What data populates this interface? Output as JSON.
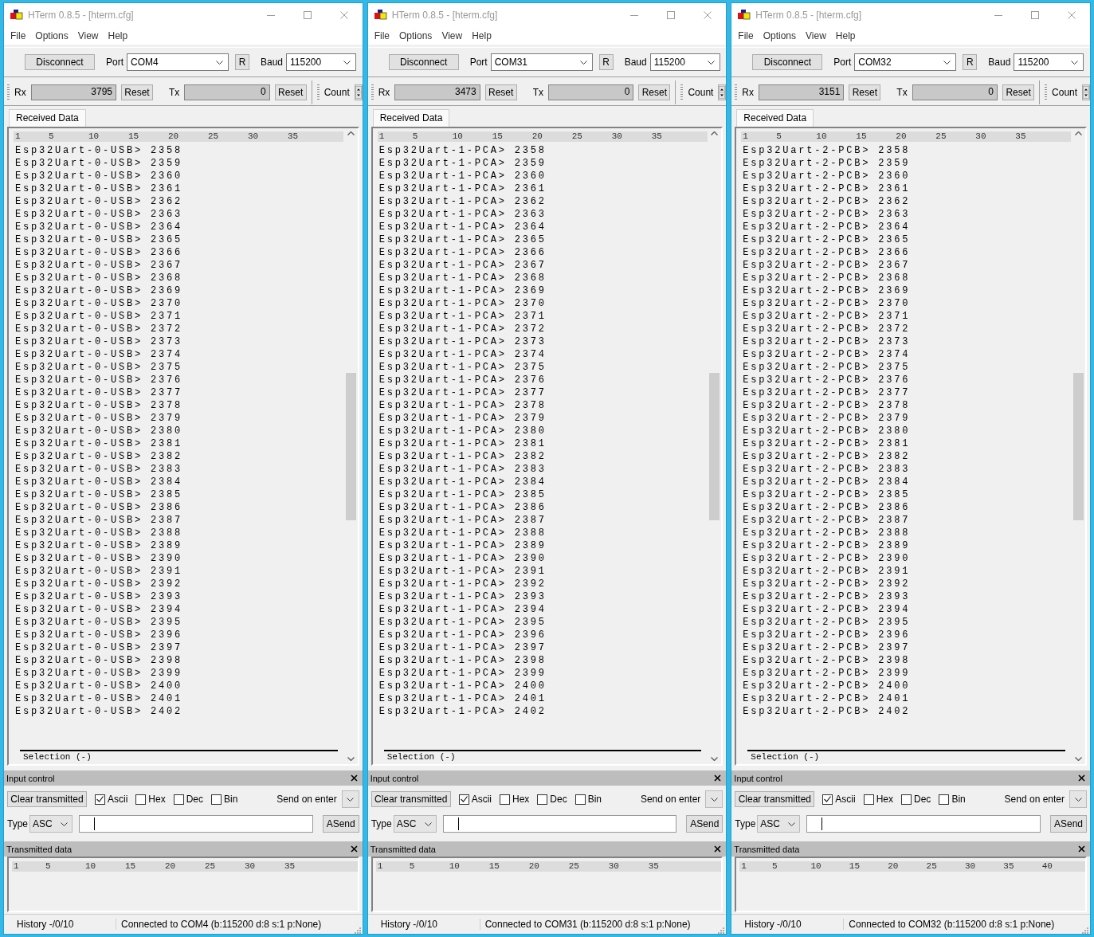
{
  "windows": [
    {
      "title": "HTerm 0.8.5 - [hterm.cfg]",
      "menu": [
        "File",
        "Options",
        "View",
        "Help"
      ],
      "connect_button": "Disconnect",
      "port_label": "Port",
      "port": "COM4",
      "refresh_button": "R",
      "baud_label": "Baud",
      "baud": "115200",
      "rx_label": "Rx",
      "rx_count": "3795",
      "rx_reset": "Reset",
      "tx_label": "Tx",
      "tx_count": "0",
      "tx_reset": "Reset",
      "count_label": "Count",
      "tabs": [
        {
          "label": "Received Data",
          "selected": true
        }
      ],
      "received_ruler": [
        "1",
        "5",
        "10",
        "15",
        "20",
        "25",
        "30",
        "35"
      ],
      "received_lines": [
        "Esp32Uart-0-USB> 2358",
        "Esp32Uart-0-USB> 2359",
        "Esp32Uart-0-USB> 2360",
        "Esp32Uart-0-USB> 2361",
        "Esp32Uart-0-USB> 2362",
        "Esp32Uart-0-USB> 2363",
        "Esp32Uart-0-USB> 2364",
        "Esp32Uart-0-USB> 2365",
        "Esp32Uart-0-USB> 2366",
        "Esp32Uart-0-USB> 2367",
        "Esp32Uart-0-USB> 2368",
        "Esp32Uart-0-USB> 2369",
        "Esp32Uart-0-USB> 2370",
        "Esp32Uart-0-USB> 2371",
        "Esp32Uart-0-USB> 2372",
        "Esp32Uart-0-USB> 2373",
        "Esp32Uart-0-USB> 2374",
        "Esp32Uart-0-USB> 2375",
        "Esp32Uart-0-USB> 2376",
        "Esp32Uart-0-USB> 2377",
        "Esp32Uart-0-USB> 2378",
        "Esp32Uart-0-USB> 2379",
        "Esp32Uart-0-USB> 2380",
        "Esp32Uart-0-USB> 2381",
        "Esp32Uart-0-USB> 2382",
        "Esp32Uart-0-USB> 2383",
        "Esp32Uart-0-USB> 2384",
        "Esp32Uart-0-USB> 2385",
        "Esp32Uart-0-USB> 2386",
        "Esp32Uart-0-USB> 2387",
        "Esp32Uart-0-USB> 2388",
        "Esp32Uart-0-USB> 2389",
        "Esp32Uart-0-USB> 2390",
        "Esp32Uart-0-USB> 2391",
        "Esp32Uart-0-USB> 2392",
        "Esp32Uart-0-USB> 2393",
        "Esp32Uart-0-USB> 2394",
        "Esp32Uart-0-USB> 2395",
        "Esp32Uart-0-USB> 2396",
        "Esp32Uart-0-USB> 2397",
        "Esp32Uart-0-USB> 2398",
        "Esp32Uart-0-USB> 2399",
        "Esp32Uart-0-USB> 2400",
        "Esp32Uart-0-USB> 2401",
        "Esp32Uart-0-USB> 2402"
      ],
      "selection_label": "Selection (-)",
      "input_control": {
        "title": "Input control",
        "clear_button": "Clear transmitted",
        "formats": [
          {
            "label": "Ascii",
            "checked": true
          },
          {
            "label": "Hex",
            "checked": false
          },
          {
            "label": "Dec",
            "checked": false
          },
          {
            "label": "Bin",
            "checked": false
          }
        ],
        "send_on_enter_label": "Send on enter",
        "type_label": "Type",
        "type_value": "ASC",
        "send_button": "ASend"
      },
      "transmitted": {
        "title": "Transmitted data",
        "ruler": [
          "1",
          "5",
          "10",
          "15",
          "20",
          "25",
          "30",
          "35"
        ]
      },
      "status": {
        "history": "History -/0/10",
        "connection": "Connected to COM4 (b:115200 d:8 s:1 p:None)"
      }
    },
    {
      "title": "HTerm 0.8.5 - [hterm.cfg]",
      "menu": [
        "File",
        "Options",
        "View",
        "Help"
      ],
      "connect_button": "Disconnect",
      "port_label": "Port",
      "port": "COM31",
      "refresh_button": "R",
      "baud_label": "Baud",
      "baud": "115200",
      "rx_label": "Rx",
      "rx_count": "3473",
      "rx_reset": "Reset",
      "tx_label": "Tx",
      "tx_count": "0",
      "tx_reset": "Reset",
      "count_label": "Count",
      "tabs": [
        {
          "label": "Received Data",
          "selected": true
        }
      ],
      "received_ruler": [
        "1",
        "5",
        "10",
        "15",
        "20",
        "25",
        "30",
        "35"
      ],
      "received_lines": [
        "Esp32Uart-1-PCA> 2358",
        "Esp32Uart-1-PCA> 2359",
        "Esp32Uart-1-PCA> 2360",
        "Esp32Uart-1-PCA> 2361",
        "Esp32Uart-1-PCA> 2362",
        "Esp32Uart-1-PCA> 2363",
        "Esp32Uart-1-PCA> 2364",
        "Esp32Uart-1-PCA> 2365",
        "Esp32Uart-1-PCA> 2366",
        "Esp32Uart-1-PCA> 2367",
        "Esp32Uart-1-PCA> 2368",
        "Esp32Uart-1-PCA> 2369",
        "Esp32Uart-1-PCA> 2370",
        "Esp32Uart-1-PCA> 2371",
        "Esp32Uart-1-PCA> 2372",
        "Esp32Uart-1-PCA> 2373",
        "Esp32Uart-1-PCA> 2374",
        "Esp32Uart-1-PCA> 2375",
        "Esp32Uart-1-PCA> 2376",
        "Esp32Uart-1-PCA> 2377",
        "Esp32Uart-1-PCA> 2378",
        "Esp32Uart-1-PCA> 2379",
        "Esp32Uart-1-PCA> 2380",
        "Esp32Uart-1-PCA> 2381",
        "Esp32Uart-1-PCA> 2382",
        "Esp32Uart-1-PCA> 2383",
        "Esp32Uart-1-PCA> 2384",
        "Esp32Uart-1-PCA> 2385",
        "Esp32Uart-1-PCA> 2386",
        "Esp32Uart-1-PCA> 2387",
        "Esp32Uart-1-PCA> 2388",
        "Esp32Uart-1-PCA> 2389",
        "Esp32Uart-1-PCA> 2390",
        "Esp32Uart-1-PCA> 2391",
        "Esp32Uart-1-PCA> 2392",
        "Esp32Uart-1-PCA> 2393",
        "Esp32Uart-1-PCA> 2394",
        "Esp32Uart-1-PCA> 2395",
        "Esp32Uart-1-PCA> 2396",
        "Esp32Uart-1-PCA> 2397",
        "Esp32Uart-1-PCA> 2398",
        "Esp32Uart-1-PCA> 2399",
        "Esp32Uart-1-PCA> 2400",
        "Esp32Uart-1-PCA> 2401",
        "Esp32Uart-1-PCA> 2402"
      ],
      "selection_label": "Selection (-)",
      "input_control": {
        "title": "Input control",
        "clear_button": "Clear transmitted",
        "formats": [
          {
            "label": "Ascii",
            "checked": true
          },
          {
            "label": "Hex",
            "checked": false
          },
          {
            "label": "Dec",
            "checked": false
          },
          {
            "label": "Bin",
            "checked": false
          }
        ],
        "send_on_enter_label": "Send on enter",
        "type_label": "Type",
        "type_value": "ASC",
        "send_button": "ASend"
      },
      "transmitted": {
        "title": "Transmitted data",
        "ruler": [
          "1",
          "5",
          "10",
          "15",
          "20",
          "25",
          "30",
          "35"
        ]
      },
      "status": {
        "history": "History -/0/10",
        "connection": "Connected to COM31 (b:115200 d:8 s:1 p:None)"
      }
    },
    {
      "title": "HTerm 0.8.5 - [hterm.cfg]",
      "menu": [
        "File",
        "Options",
        "View",
        "Help"
      ],
      "connect_button": "Disconnect",
      "port_label": "Port",
      "port": "COM32",
      "refresh_button": "R",
      "baud_label": "Baud",
      "baud": "115200",
      "rx_label": "Rx",
      "rx_count": "3151",
      "rx_reset": "Reset",
      "tx_label": "Tx",
      "tx_count": "0",
      "tx_reset": "Reset",
      "count_label": "Count",
      "tabs": [
        {
          "label": "Received Data",
          "selected": true
        }
      ],
      "received_ruler": [
        "1",
        "5",
        "10",
        "15",
        "20",
        "25",
        "30",
        "35"
      ],
      "received_lines": [
        "Esp32Uart-2-PCB> 2358",
        "Esp32Uart-2-PCB> 2359",
        "Esp32Uart-2-PCB> 2360",
        "Esp32Uart-2-PCB> 2361",
        "Esp32Uart-2-PCB> 2362",
        "Esp32Uart-2-PCB> 2363",
        "Esp32Uart-2-PCB> 2364",
        "Esp32Uart-2-PCB> 2365",
        "Esp32Uart-2-PCB> 2366",
        "Esp32Uart-2-PCB> 2367",
        "Esp32Uart-2-PCB> 2368",
        "Esp32Uart-2-PCB> 2369",
        "Esp32Uart-2-PCB> 2370",
        "Esp32Uart-2-PCB> 2371",
        "Esp32Uart-2-PCB> 2372",
        "Esp32Uart-2-PCB> 2373",
        "Esp32Uart-2-PCB> 2374",
        "Esp32Uart-2-PCB> 2375",
        "Esp32Uart-2-PCB> 2376",
        "Esp32Uart-2-PCB> 2377",
        "Esp32Uart-2-PCB> 2378",
        "Esp32Uart-2-PCB> 2379",
        "Esp32Uart-2-PCB> 2380",
        "Esp32Uart-2-PCB> 2381",
        "Esp32Uart-2-PCB> 2382",
        "Esp32Uart-2-PCB> 2383",
        "Esp32Uart-2-PCB> 2384",
        "Esp32Uart-2-PCB> 2385",
        "Esp32Uart-2-PCB> 2386",
        "Esp32Uart-2-PCB> 2387",
        "Esp32Uart-2-PCB> 2388",
        "Esp32Uart-2-PCB> 2389",
        "Esp32Uart-2-PCB> 2390",
        "Esp32Uart-2-PCB> 2391",
        "Esp32Uart-2-PCB> 2392",
        "Esp32Uart-2-PCB> 2393",
        "Esp32Uart-2-PCB> 2394",
        "Esp32Uart-2-PCB> 2395",
        "Esp32Uart-2-PCB> 2396",
        "Esp32Uart-2-PCB> 2397",
        "Esp32Uart-2-PCB> 2398",
        "Esp32Uart-2-PCB> 2399",
        "Esp32Uart-2-PCB> 2400",
        "Esp32Uart-2-PCB> 2401",
        "Esp32Uart-2-PCB> 2402"
      ],
      "selection_label": "Selection (-)",
      "input_control": {
        "title": "Input control",
        "clear_button": "Clear transmitted",
        "formats": [
          {
            "label": "Ascii",
            "checked": true
          },
          {
            "label": "Hex",
            "checked": false
          },
          {
            "label": "Dec",
            "checked": false
          },
          {
            "label": "Bin",
            "checked": false
          }
        ],
        "send_on_enter_label": "Send on enter",
        "type_label": "Type",
        "type_value": "ASC",
        "send_button": "ASend"
      },
      "transmitted": {
        "title": "Transmitted data",
        "ruler": [
          "1",
          "5",
          "10",
          "15",
          "20",
          "25",
          "30",
          "35",
          "40"
        ]
      },
      "status": {
        "history": "History -/0/10",
        "connection": "Connected to COM32 (b:115200 d:8 s:1 p:None)"
      }
    }
  ]
}
